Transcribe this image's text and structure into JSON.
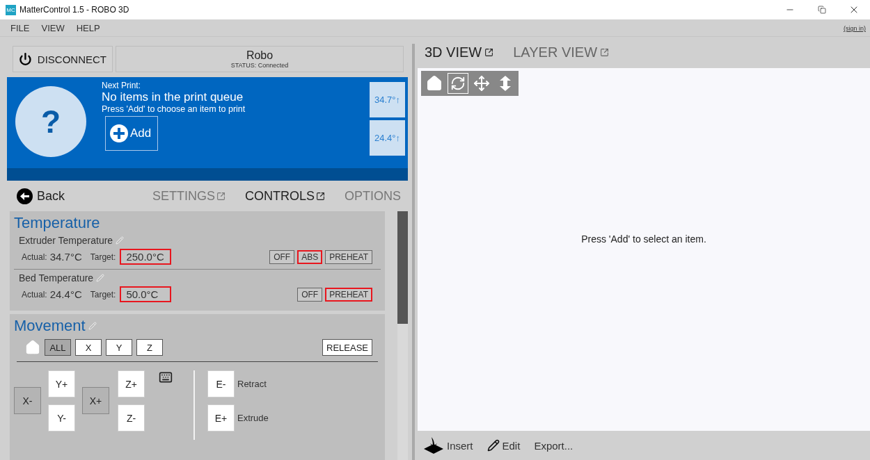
{
  "window": {
    "app_icon": "MC",
    "title": "MatterControl 1.5 - ROBO 3D"
  },
  "menu": [
    "FILE",
    "VIEW",
    "HELP"
  ],
  "sign_in": "(sign in)",
  "printer": {
    "disconnect": "DISCONNECT",
    "name": "Robo",
    "status": "STATUS: Connected"
  },
  "queue": {
    "glyph": "?",
    "label": "Next Print:",
    "title": "No items in the print queue",
    "hint": "Press 'Add' to choose an item to print",
    "add": "Add",
    "temps": [
      "34.7°↑",
      "24.4°↑"
    ]
  },
  "nav": {
    "back": "Back",
    "tabs": [
      {
        "label": "SETTINGS",
        "selected": false,
        "popout": true
      },
      {
        "label": "CONTROLS",
        "selected": true,
        "popout": true
      },
      {
        "label": "OPTIONS",
        "selected": false,
        "popout": false
      }
    ]
  },
  "temperature": {
    "title": "Temperature",
    "heaters": [
      {
        "name": "Extruder Temperature",
        "actual_label": "Actual:",
        "actual": "34.7°C",
        "target_label": "Target:",
        "target": "250.0°C",
        "target_highlighted": true,
        "buttons": [
          {
            "label": "OFF",
            "highlighted": false
          },
          {
            "label": "ABS",
            "highlighted": true
          },
          {
            "label": "PREHEAT",
            "highlighted": false
          }
        ]
      },
      {
        "name": "Bed Temperature",
        "actual_label": "Actual:",
        "actual": "24.4°C",
        "target_label": "Target:",
        "target": "50.0°C",
        "target_highlighted": true,
        "buttons": [
          {
            "label": "OFF",
            "highlighted": false
          },
          {
            "label": "PREHEAT",
            "highlighted": true
          }
        ]
      }
    ]
  },
  "movement": {
    "title": "Movement",
    "home_buttons": [
      {
        "label": "ALL",
        "selected": true
      },
      {
        "label": "X",
        "selected": false
      },
      {
        "label": "Y",
        "selected": false
      },
      {
        "label": "Z",
        "selected": false
      }
    ],
    "release": "RELEASE",
    "jog": {
      "x_minus": {
        "label": "X-",
        "shaded": true
      },
      "y_plus": {
        "label": "Y+",
        "shaded": false
      },
      "y_minus": {
        "label": "Y-",
        "shaded": false
      },
      "x_plus": {
        "label": "X+",
        "shaded": true
      },
      "z_plus": {
        "label": "Z+",
        "shaded": false
      },
      "z_minus": {
        "label": "Z-",
        "shaded": false
      }
    },
    "extruder": [
      {
        "label": "E-",
        "text": "Retract"
      },
      {
        "label": "E+",
        "text": "Extrude"
      }
    ]
  },
  "view_tabs": [
    {
      "label": "3D VIEW",
      "selected": true
    },
    {
      "label": "LAYER VIEW",
      "selected": false
    }
  ],
  "view_tools": [
    {
      "kind": "home",
      "selected": false
    },
    {
      "kind": "rotate",
      "selected": true
    },
    {
      "kind": "move",
      "selected": false
    },
    {
      "kind": "zoom",
      "selected": false
    }
  ],
  "message": "Press 'Add' to select an item.",
  "actions": [
    {
      "kind": "insert",
      "label": "Insert"
    },
    {
      "kind": "edit",
      "label": "Edit"
    },
    {
      "kind": "export",
      "label": "Export..."
    }
  ]
}
